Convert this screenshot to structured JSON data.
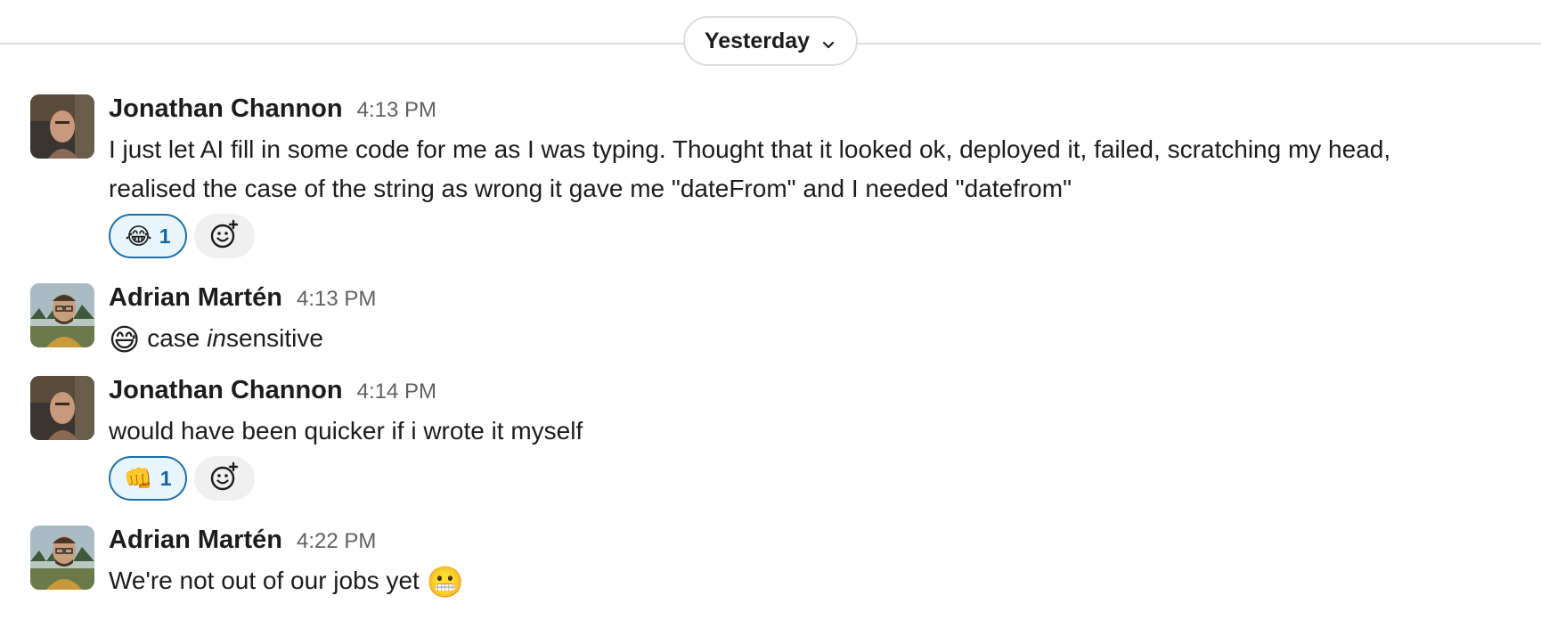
{
  "divider": {
    "label": "Yesterday",
    "icon": "chevron-down-icon"
  },
  "messages": [
    {
      "author": "Jonathan Channon",
      "time": "4:13 PM",
      "line1": "I just let AI fill in some code for me as I was typing. Thought that it looked ok, deployed it, failed, scratching my head,",
      "line2": "realised the case of the string as wrong it gave me \"dateFrom\" and I needed \"datefrom\"",
      "reaction_emoji": "😂",
      "reaction_count": "1",
      "add_reaction_icon": "add-emoji-icon"
    },
    {
      "author": "Adrian Martén",
      "time": "4:13 PM",
      "emoji": "😅",
      "text_before": "case ",
      "text_italic": "in",
      "text_after": "sensitive"
    },
    {
      "author": "Jonathan Channon",
      "time": "4:14 PM",
      "text": "would have been quicker if i wrote it myself",
      "reaction_emoji": "👊",
      "reaction_count": "1",
      "add_reaction_icon": "add-emoji-icon"
    },
    {
      "author": "Adrian Martén",
      "time": "4:22 PM",
      "text": "We're not out of our jobs yet",
      "emoji": "😬"
    }
  ],
  "colors": {
    "reaction_border": "#1d6fa5",
    "reaction_bg": "#e8f5fa",
    "timestamp": "#616061"
  }
}
